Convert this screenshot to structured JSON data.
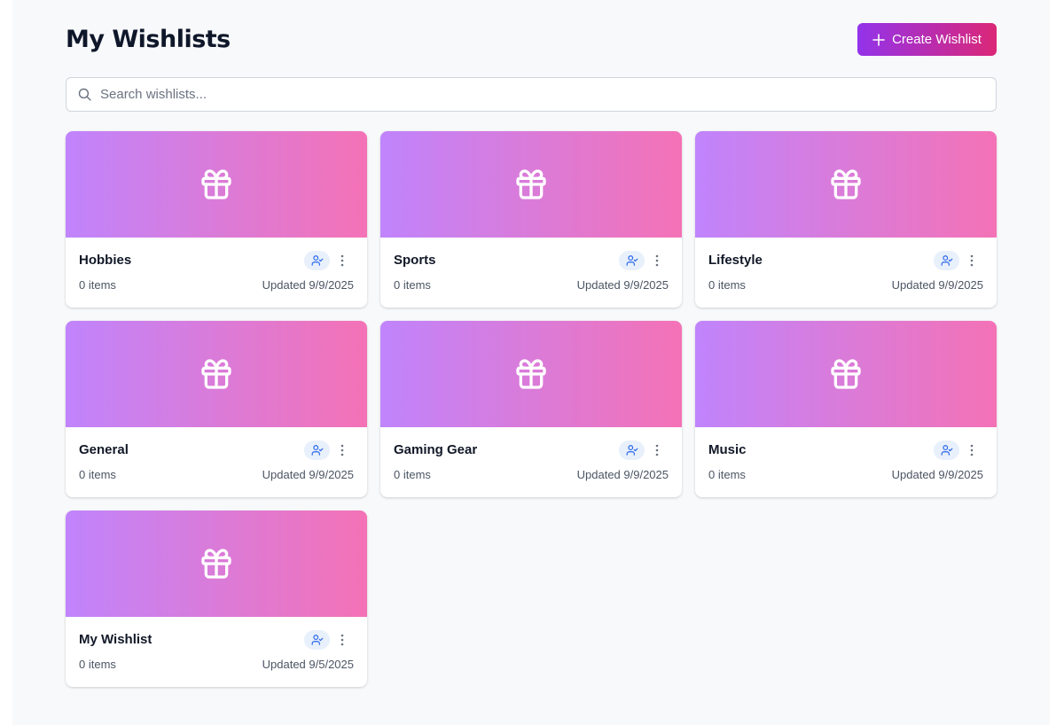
{
  "header": {
    "title": "My Wishlists",
    "create_label": "Create Wishlist"
  },
  "search": {
    "placeholder": "Search wishlists...",
    "value": ""
  },
  "colors": {
    "button_gradient": [
      "#9333ea",
      "#db2777"
    ],
    "banner_gradient": [
      "#c084fc",
      "#f472b6"
    ],
    "shared_badge_bg": "#e8f0fb",
    "shared_icon": "#2563eb"
  },
  "icons": {
    "create": "plus-icon",
    "search": "search-icon",
    "banner": "gift-icon",
    "shared": "user-check-icon",
    "menu": "more-vertical-icon"
  },
  "wishlists": [
    {
      "name": "Hobbies",
      "count": "0 items",
      "updated": "Updated 9/9/2025"
    },
    {
      "name": "Sports",
      "count": "0 items",
      "updated": "Updated 9/9/2025"
    },
    {
      "name": "Lifestyle",
      "count": "0 items",
      "updated": "Updated 9/9/2025"
    },
    {
      "name": "General",
      "count": "0 items",
      "updated": "Updated 9/9/2025"
    },
    {
      "name": "Gaming Gear",
      "count": "0 items",
      "updated": "Updated 9/9/2025"
    },
    {
      "name": "Music",
      "count": "0 items",
      "updated": "Updated 9/9/2025"
    },
    {
      "name": "My Wishlist",
      "count": "0 items",
      "updated": "Updated 9/5/2025"
    }
  ]
}
